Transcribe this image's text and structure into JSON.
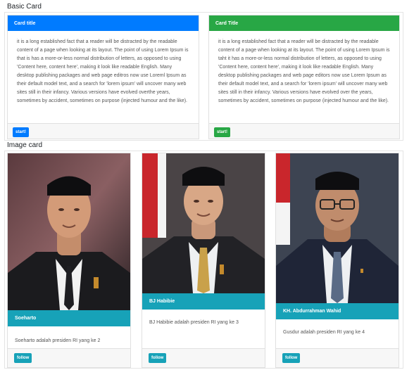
{
  "sections": {
    "basic_title": "Basic Card",
    "image_title": "Image card"
  },
  "basic_cards": [
    {
      "title": "Card title",
      "header_color": "#007bff",
      "body": "it is a long established fact that a reader will be distracted by the readable content of a page when looking at its layout. The point of using Lorem Ipsum is that is has a more-or-less normal distribution of letters, as opposed to using 'Content here, content here', making it look like readable English. Many desktop publishing packages and web page editros now use Loreml Ipsum as their default model text, and a search for 'lorem ipsum' will uncover many web sites still in their infancy. Various versions have evolved overthe years, sometimes by accident, sometimes on purpose (injected humour and the like).",
      "button": "start!",
      "button_color": "#007bff"
    },
    {
      "title": "Card Title",
      "header_color": "#28a745",
      "body": "it is a long established fact that a reader will be distracted by the readable content of a page when looking at its layout. The point of using Lorem Ipsum is taht it has a more-or-less normal distribution of letters, as opposed to using 'Content here, content here', making it look like readable English. Many desktop publishing packages and web page editors now use Lorem Ipsum as their default model text, and a search for 'lorem ipsum' will uncover many web sites still in their infancy. Various versions have evolved over the years, sometimes by accident, sometimes on purpose (injected humour and the like).",
      "button": "start!",
      "button_color": "#28a745"
    }
  ],
  "image_cards": [
    {
      "name": "Soeharto",
      "desc": "Soeharto adalah presiden RI yang ke 2",
      "button": "follow",
      "icon": "portrait-photo"
    },
    {
      "name": "BJ Habibie",
      "desc": "BJ Habibie adalah presiden RI yang ke 3",
      "button": "follow",
      "icon": "portrait-photo"
    },
    {
      "name": "KH. Abdurrahman Wahid",
      "desc": "Gusdur adalah presiden RI yang ke 4",
      "button": "follow",
      "icon": "portrait-photo"
    }
  ],
  "colors": {
    "accent_teal": "#17a2b8",
    "primary": "#007bff",
    "success": "#28a745"
  }
}
